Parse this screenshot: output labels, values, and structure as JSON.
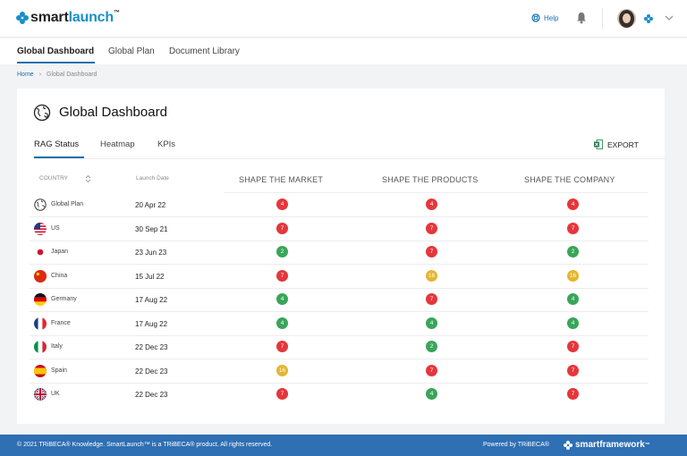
{
  "brand": {
    "name_prefix": "smart",
    "name_accent": "launch",
    "tm": "™",
    "color": "#1a8fc9"
  },
  "header": {
    "help_label": "Help",
    "help_icon": "lifebuoy-icon",
    "bell_icon": "bell-icon",
    "chevron_icon": "chevron-down-icon"
  },
  "nav": {
    "items": [
      {
        "label": "Global Dashboard",
        "active": true
      },
      {
        "label": "Global Plan",
        "active": false
      },
      {
        "label": "Document Library",
        "active": false
      }
    ]
  },
  "breadcrumb": {
    "home": "Home",
    "current": "Global Dashboard"
  },
  "page": {
    "title": "Global Dashboard",
    "title_icon": "globe-icon"
  },
  "tabs": [
    {
      "label": "RAG Status",
      "active": true
    },
    {
      "label": "Heatmap",
      "active": false
    },
    {
      "label": "KPIs",
      "active": false
    }
  ],
  "export": {
    "label": "EXPORT",
    "icon": "excel-icon"
  },
  "table": {
    "headers": {
      "country": "COUNTRY",
      "launch_date": "Launch Date",
      "market": "SHAPE THE MARKET",
      "products": "SHAPE THE PRODUCTS",
      "company": "SHAPE THE COMPANY"
    },
    "status_colors": {
      "red": "#e5363b",
      "green": "#3aa55a",
      "amber": "#e4b630"
    },
    "rows": [
      {
        "country": "Global Plan",
        "flag": "globe",
        "date": "20 Apr 22",
        "market": {
          "value": "4",
          "status": "red"
        },
        "products": {
          "value": "4",
          "status": "red"
        },
        "company": {
          "value": "4",
          "status": "red"
        }
      },
      {
        "country": "US",
        "flag": "us",
        "date": "30 Sep 21",
        "market": {
          "value": "7",
          "status": "red"
        },
        "products": {
          "value": "7",
          "status": "red"
        },
        "company": {
          "value": "7",
          "status": "red"
        }
      },
      {
        "country": "Japan",
        "flag": "jp",
        "date": "23 Jun 23",
        "market": {
          "value": "2",
          "status": "green"
        },
        "products": {
          "value": "7",
          "status": "red"
        },
        "company": {
          "value": "2",
          "status": "green"
        }
      },
      {
        "country": "China",
        "flag": "cn",
        "date": "15 Jul 22",
        "market": {
          "value": "7",
          "status": "red"
        },
        "products": {
          "value": "16",
          "status": "amber"
        },
        "company": {
          "value": "16",
          "status": "amber"
        }
      },
      {
        "country": "Germany",
        "flag": "de",
        "date": "17 Aug 22",
        "market": {
          "value": "4",
          "status": "green"
        },
        "products": {
          "value": "7",
          "status": "red"
        },
        "company": {
          "value": "4",
          "status": "green"
        }
      },
      {
        "country": "France",
        "flag": "fr",
        "date": "17 Aug 22",
        "market": {
          "value": "4",
          "status": "green"
        },
        "products": {
          "value": "4",
          "status": "green"
        },
        "company": {
          "value": "4",
          "status": "green"
        }
      },
      {
        "country": "Italy",
        "flag": "it",
        "date": "22 Dec 23",
        "market": {
          "value": "7",
          "status": "red"
        },
        "products": {
          "value": "2",
          "status": "green"
        },
        "company": {
          "value": "7",
          "status": "red"
        }
      },
      {
        "country": "Spain",
        "flag": "es",
        "date": "22 Dec 23",
        "market": {
          "value": "16",
          "status": "amber"
        },
        "products": {
          "value": "7",
          "status": "red"
        },
        "company": {
          "value": "7",
          "status": "red"
        }
      },
      {
        "country": "UK",
        "flag": "gb",
        "date": "22 Dec 23",
        "market": {
          "value": "7",
          "status": "red"
        },
        "products": {
          "value": "4",
          "status": "green"
        },
        "company": {
          "value": "7",
          "status": "red"
        }
      }
    ]
  },
  "footer": {
    "copyright": "© 2021 TRiBECA® Knowledge. SmartLaunch™ is a TRiBECA® product. All rights reserved.",
    "powered": "Powered by TRiBECA®",
    "framework_prefix": "smart",
    "framework_suffix": "framework",
    "framework_tm": "™",
    "color": "#2f6fb3"
  }
}
